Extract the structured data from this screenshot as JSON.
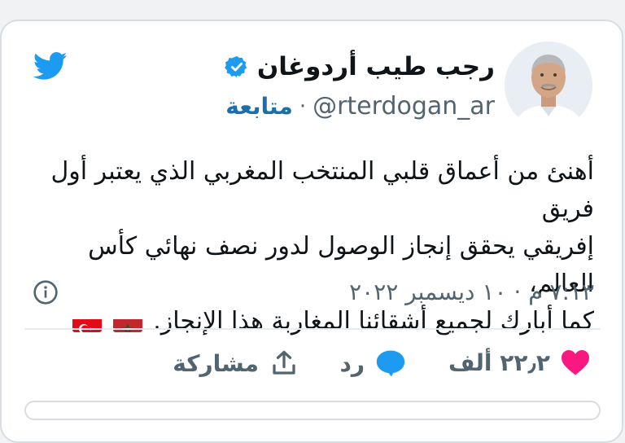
{
  "tweet": {
    "author_name": "رجب طيب أردوغان",
    "handle": "@rterdogan_ar",
    "separator": "·",
    "follow_label": "متابعة",
    "text_line1": "أهنئ من أعماق قلبي المنتخب المغربي الذي يعتبر أول فريق",
    "text_line2": "إفريقي يحقق إنجاز الوصول لدور نصف نهائي كأس العالم،",
    "text_line3": "كما أبارك لجميع أشقائنا المغاربة هذا الإنجاز.",
    "timestamp": "٧:١٣ م · ١٠ ديسمبر ٢٠٢٢",
    "flags": [
      "morocco-flag",
      "turkey-flag"
    ]
  },
  "actions": {
    "like_count": "٢٢٫٢ ألف",
    "reply_label": "رد",
    "share_label": "مشاركة"
  },
  "colors": {
    "twitter_blue": "#1d9bf0",
    "like_pink": "#f91880",
    "text_primary": "#0f1419",
    "text_secondary": "#536471",
    "follow_blue": "#1d6fa9"
  },
  "icons": [
    "twitter-bird-icon",
    "verified-badge-icon",
    "info-icon",
    "heart-icon",
    "reply-bubble-icon",
    "share-icon"
  ]
}
